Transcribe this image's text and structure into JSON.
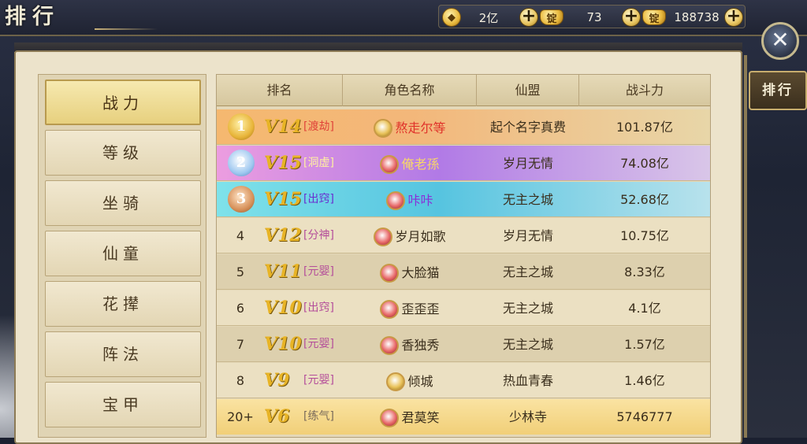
{
  "header": {
    "title": "排行",
    "currencies": [
      {
        "icon": "copper-coin-icon",
        "value": "2亿"
      },
      {
        "icon": "silver-ingot-icon",
        "value": "73"
      },
      {
        "icon": "gold-ingot-icon",
        "value": "188738"
      }
    ],
    "add_label": "+",
    "close_label": "✕"
  },
  "side_tab": {
    "label": "排行"
  },
  "menu": {
    "items": [
      {
        "label": "战力",
        "active": true
      },
      {
        "label": "等级"
      },
      {
        "label": "坐骑"
      },
      {
        "label": "仙童"
      },
      {
        "label": "花撵"
      },
      {
        "label": "阵法"
      },
      {
        "label": "宝甲"
      }
    ]
  },
  "table": {
    "columns": [
      "排名",
      "角色名称",
      "仙盟",
      "战斗力"
    ],
    "rows": [
      {
        "rank": "1",
        "vip": "V14",
        "realm": "[渡劫]",
        "name": "熬走尔等",
        "guild": "起个名字真费",
        "power": "101.87亿"
      },
      {
        "rank": "2",
        "vip": "V15",
        "realm": "[洞虚]",
        "name": "俺老孫",
        "guild": "岁月无情",
        "power": "74.08亿"
      },
      {
        "rank": "3",
        "vip": "V15",
        "realm": "[出窍]",
        "name": "咔咔",
        "guild": "无主之城",
        "power": "52.68亿"
      },
      {
        "rank": "4",
        "vip": "V12",
        "realm": "[分神]",
        "name": "岁月如歌",
        "guild": "岁月无情",
        "power": "10.75亿"
      },
      {
        "rank": "5",
        "vip": "V11",
        "realm": "[元婴]",
        "name": "大脸猫",
        "guild": "无主之城",
        "power": "8.33亿"
      },
      {
        "rank": "6",
        "vip": "V10",
        "realm": "[出窍]",
        "name": "歪歪歪",
        "guild": "无主之城",
        "power": "4.1亿"
      },
      {
        "rank": "7",
        "vip": "V10",
        "realm": "[元婴]",
        "name": "香独秀",
        "guild": "无主之城",
        "power": "1.57亿"
      },
      {
        "rank": "8",
        "vip": "V9",
        "realm": "[元婴]",
        "name": "倾城",
        "guild": "热血青春",
        "power": "1.46亿"
      },
      {
        "rank": "20+",
        "vip": "V6",
        "realm": "[练气]",
        "name": "君莫笑",
        "guild": "少林寺",
        "power": "5746777"
      }
    ]
  }
}
